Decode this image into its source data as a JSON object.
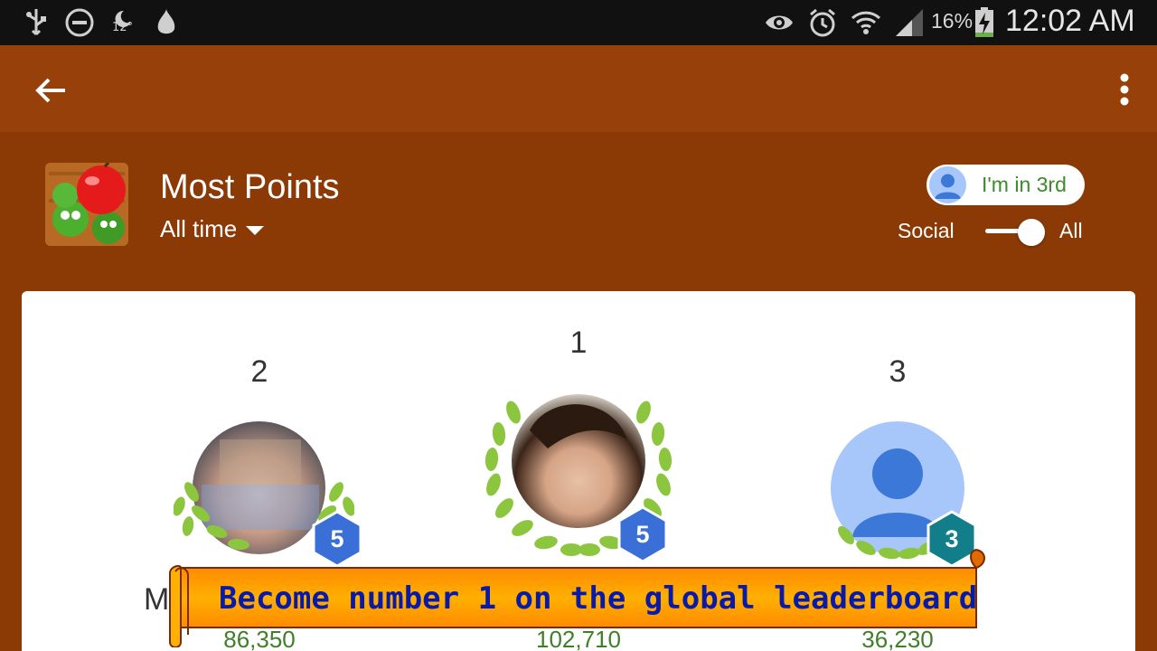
{
  "status_bar": {
    "temperature": "12°",
    "battery_percent": "16%",
    "time": "12:02 AM",
    "icons": [
      "usb-icon",
      "do-not-disturb-icon",
      "weather-night-icon",
      "garlic-icon",
      "eye-icon",
      "alarm-icon",
      "wifi-icon",
      "signal-icon",
      "battery-charging-icon"
    ]
  },
  "app_bar": {
    "back_icon": "arrow-back-icon",
    "menu_icon": "more-vert-icon"
  },
  "leaderboard": {
    "title": "Most Points",
    "time_filter": "All time",
    "my_rank_label": "I'm in 3rd",
    "toggle_left": "Social",
    "toggle_right": "All",
    "toggle_state": "All"
  },
  "podium": [
    {
      "rank": "2",
      "level": "5",
      "score": "86,350",
      "badge_color": "#3a6fd8"
    },
    {
      "rank": "1",
      "level": "5",
      "score": "102,710",
      "badge_color": "#3a6fd8"
    },
    {
      "rank": "3",
      "level": "3",
      "score": "36,230",
      "badge_color": "#117e8a"
    }
  ],
  "partial_name_letter": "M",
  "banner": {
    "text": "Become number 1 on the global leaderboard"
  },
  "colors": {
    "status_bar": "#111111",
    "app_bar": "#97400a",
    "header": "#8b3a06",
    "score_green": "#3f7f2a",
    "banner_text": "#0a1aa8",
    "banner_fill": "#ff9a00"
  }
}
